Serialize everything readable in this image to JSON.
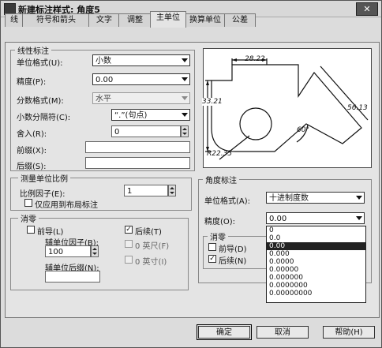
{
  "window": {
    "title": "新建标注样式: 角度5",
    "close": "✕"
  },
  "tabs": [
    {
      "label": "线"
    },
    {
      "label": "符号和箭头"
    },
    {
      "label": "文字"
    },
    {
      "label": "调整"
    },
    {
      "label": "主单位"
    },
    {
      "label": "换算单位"
    },
    {
      "label": "公差"
    }
  ],
  "linear": {
    "title": "线性标注",
    "unit_format_label": "单位格式(U):",
    "unit_format_value": "小数",
    "precision_label": "精度(P):",
    "precision_value": "0.00",
    "fraction_format_label": "分数格式(M):",
    "fraction_format_value": "水平",
    "decimal_sep_label": "小数分隔符(C):",
    "decimal_sep_value": "“.”(句点)",
    "round_label": "舍入(R):",
    "round_value": "0",
    "prefix_label": "前缀(X):",
    "prefix_value": "",
    "suffix_label": "后缀(S):",
    "suffix_value": ""
  },
  "scale": {
    "title": "测量单位比例",
    "factor_label": "比例因子(E):",
    "factor_value": "1",
    "layout_only_label": "仅应用到布局标注"
  },
  "zero_linear": {
    "title": "消零",
    "leading_label": "前导(L)",
    "trailing_label": "后续(T)",
    "sub_factor_label": "辅单位因子(B):",
    "sub_factor_value": "100",
    "feet_label": "0 英尺(F)",
    "inch_label": "0 英寸(I)",
    "sub_suffix_label": "辅单位后缀(N):",
    "sub_suffix_value": ""
  },
  "angular": {
    "title": "角度标注",
    "unit_format_label": "单位格式(A):",
    "unit_format_value": "十进制度数",
    "precision_label": "精度(O):",
    "precision_value": "0.00",
    "zero_title": "消零",
    "leading_label": "前导(D)",
    "trailing_label": "后续(N)"
  },
  "precision_options": [
    "0",
    "0.0",
    "0.00",
    "0.000",
    "0.0000",
    "0.00000",
    "0.000000",
    "0.0000000",
    "0.00000000"
  ],
  "preview": {
    "dim_top": "28.22",
    "dim_left": "33.21",
    "dim_right": "56.13",
    "dim_angle": "60°",
    "dim_radius": "R22.35"
  },
  "buttons": {
    "ok": "确定",
    "cancel": "取消",
    "help": "帮助(H)"
  }
}
